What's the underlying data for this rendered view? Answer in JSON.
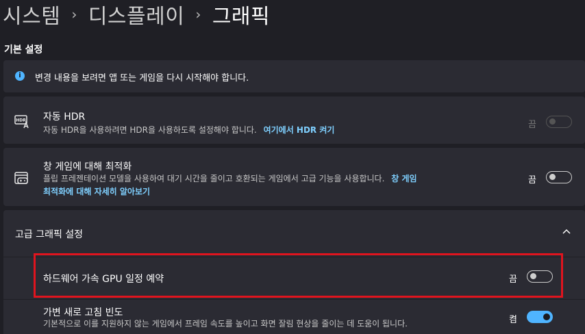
{
  "breadcrumb": [
    "시스템",
    "디스플레이",
    "그래픽"
  ],
  "section_title": "기본 설정",
  "info": {
    "icon": "info-icon",
    "text": "변경 내용을 보려면 앱 또는 게임을 다시 시작해야 합니다."
  },
  "auto_hdr": {
    "icon": "hdr-icon",
    "title": "자동 HDR",
    "desc": "자동 HDR을 사용하려면 HDR을 사용하도록 설정해야 합니다.",
    "link": "여기에서 HDR 켜기",
    "state": "끔",
    "toggle_on": false,
    "disabled": true
  },
  "windowed_opt": {
    "icon": "game-controller-icon",
    "title": "창 게임에 대해 최적화",
    "desc_line1": "플립 프레젠테이션 모델을 사용하여 대기 시간을 줄이고 호환되는 게임에서 고급 기능을 사용합니다.",
    "link_line1": "창 게임",
    "link_line2": "최적화에 대해 자세히 알아보기",
    "state": "끔",
    "toggle_on": false
  },
  "advanced": {
    "title": "고급 그래픽 설정",
    "icon": "chevron-up-icon",
    "expanded": true
  },
  "gpu_scheduling": {
    "title": "하드웨어 가속 GPU 일정 예약",
    "state": "끔",
    "toggle_on": false
  },
  "vrr": {
    "title": "가변 새로 고침 빈도",
    "desc": "기본적으로 이를 지원하지 않는 게임에서 프레임 속도를 높이고 화면 잘림 현상을 줄이는 데 도움이 됩니다.",
    "state": "켬",
    "toggle_on": true
  },
  "colors": {
    "background": "#1f1f25",
    "card": "#2b2b33",
    "accent": "#4fb4ff",
    "link": "#7fd0ff",
    "highlight": "#e0141e"
  }
}
